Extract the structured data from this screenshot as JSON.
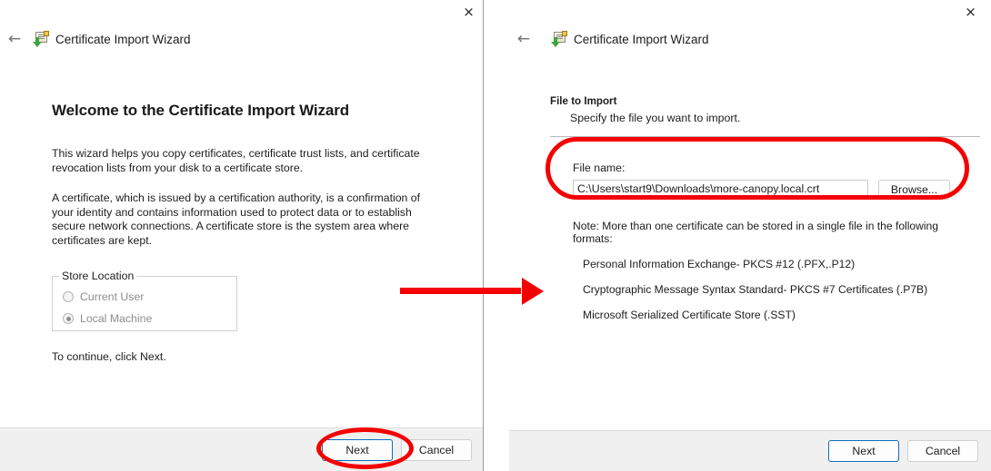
{
  "left_window": {
    "close_icon": "×",
    "back_icon": "←",
    "app_icon": "certificate-import-icon",
    "title": "Certificate Import Wizard",
    "heading": "Welcome to the Certificate Import Wizard",
    "paragraph_1": "This wizard helps you copy certificates, certificate trust lists, and certificate revocation lists from your disk to a certificate store.",
    "paragraph_2": "A certificate, which is issued by a certification authority, is a confirmation of your identity and contains information used to protect data or to establish secure network connections. A certificate store is the system area where certificates are kept.",
    "store_location": {
      "legend": "Store Location",
      "options": [
        {
          "label": "Current User",
          "selected": false,
          "disabled": true
        },
        {
          "label": "Local Machine",
          "selected": true,
          "disabled": true
        }
      ]
    },
    "continue_text": "To continue, click Next.",
    "buttons": {
      "next": "Next",
      "cancel": "Cancel"
    }
  },
  "right_window": {
    "close_icon": "×",
    "back_icon": "←",
    "app_icon": "certificate-import-icon",
    "title": "Certificate Import Wizard",
    "step_heading": "File to Import",
    "step_subheading": "Specify the file you want to import.",
    "file_field": {
      "label": "File name:",
      "value": "C:\\Users\\start9\\Downloads\\more-canopy.local.crt",
      "placeholder": "",
      "browse_label": "Browse..."
    },
    "note_intro": "Note:  More than one certificate can be stored in a single file in the following formats:",
    "note_formats": [
      "Personal Information Exchange- PKCS #12 (.PFX,.P12)",
      "Cryptographic Message Syntax Standard- PKCS #7 Certificates (.P7B)",
      "Microsoft Serialized Certificate Store (.SST)"
    ],
    "buttons": {
      "next": "Next",
      "cancel": "Cancel"
    }
  },
  "annotations": {
    "highlight_color": "#f40000",
    "arrow_name": "red-flow-arrow",
    "circle_next_name": "red-highlight-next-button",
    "circle_file_name": "red-highlight-file-name-field"
  }
}
